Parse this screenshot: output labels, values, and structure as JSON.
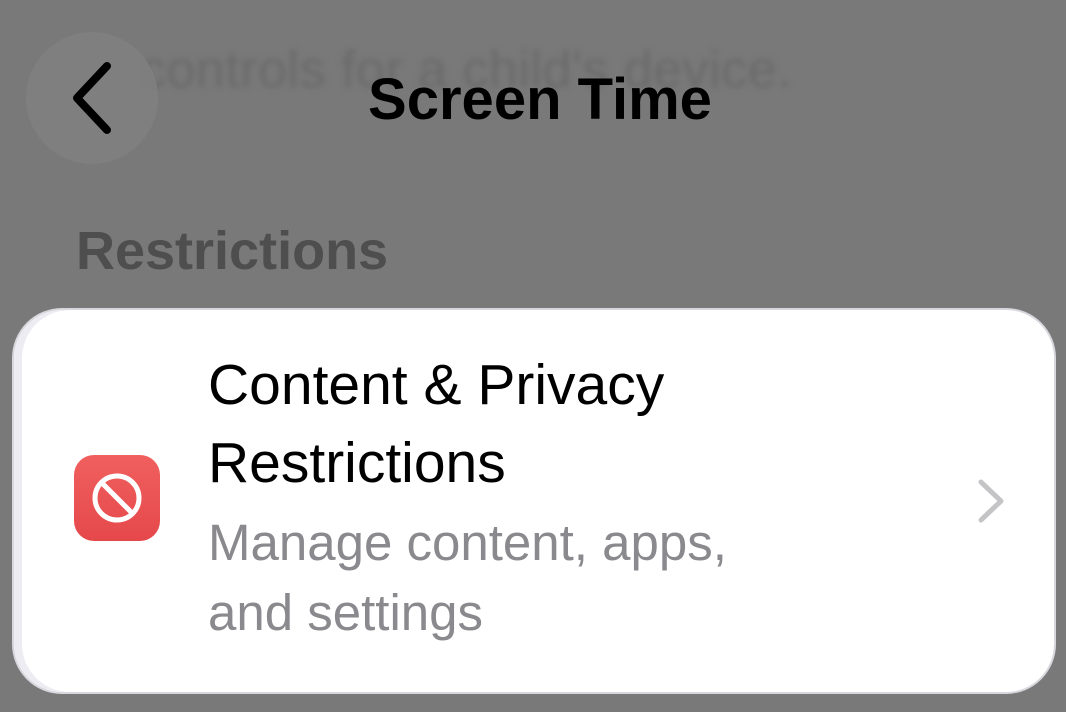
{
  "background": {
    "blurred_text": "controls for a child's device."
  },
  "nav": {
    "title": "Screen Time",
    "back_icon": "chevron-left-icon"
  },
  "section": {
    "header": "Restrictions"
  },
  "row": {
    "icon": "restricted-icon",
    "icon_color": "#eb5254",
    "title_line1": "Content & Privacy",
    "title_line2": "Restrictions",
    "subtitle_line1": "Manage content, apps,",
    "subtitle_line2": "and settings",
    "chevron_icon": "chevron-right-icon"
  },
  "colors": {
    "background": "#797979",
    "card": "#ffffff",
    "secondary_text": "#8a8a8e",
    "section_header": "#4e4e4e"
  }
}
